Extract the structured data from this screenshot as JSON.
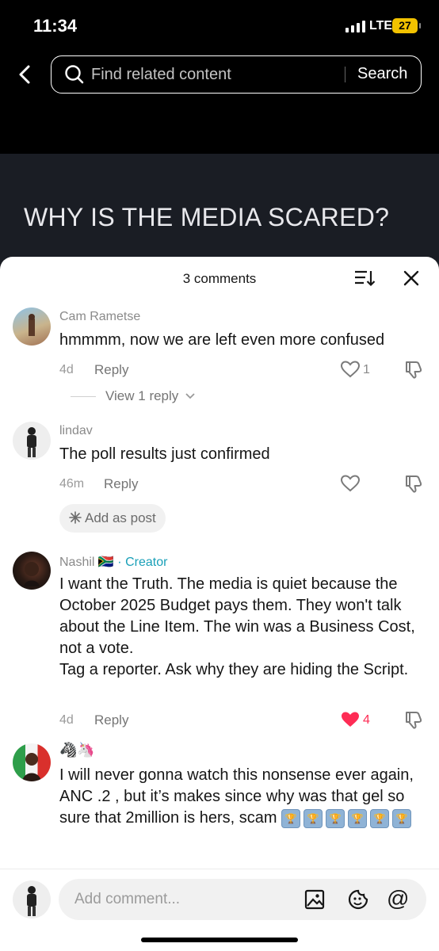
{
  "status_bar": {
    "time": "11:34",
    "network": "LTE",
    "battery": "27"
  },
  "search": {
    "placeholder": "Find related content",
    "button_label": "Search"
  },
  "video": {
    "title": "WHY IS THE MEDIA SCARED?"
  },
  "comments_sheet": {
    "title": "3 comments",
    "comments": [
      {
        "username": "Cam Rametse",
        "text": "hmmmm, now we are left even more confused",
        "age": "4d",
        "reply_label": "Reply",
        "likes": "1",
        "view_replies": "View 1 reply"
      },
      {
        "username": "lindav",
        "text": "The poll results just confirmed",
        "age": "46m",
        "reply_label": "Reply",
        "add_as_post": "Add as post"
      },
      {
        "username": "Nashil",
        "flag": "🇿🇦",
        "creator_label": "· Creator",
        "text": "I want the Truth. The media is quiet because the October 2025 Budget pays them. They won't talk about the Line Item. The win was a Business Cost, not a vote.\nTag a reporter. Ask why they are hiding the Script.",
        "age": "4d",
        "reply_label": "Reply",
        "likes": "4"
      },
      {
        "username": "🦓🦄",
        "text": "I will never gonna watch this nonsense ever again, ANC .2 , but it’s makes since why was that gel so sure that 2million is hers, scam"
      }
    ]
  },
  "comment_input": {
    "placeholder": "Add comment..."
  },
  "colors": {
    "liked": "#fe2c55",
    "creator": "#1aa0b8",
    "sheet_bg": "#ffffff"
  },
  "icons": [
    "back-icon",
    "search-icon",
    "sort-icon",
    "close-icon",
    "heart-icon",
    "dislike-icon",
    "sparkle-icon",
    "image-icon",
    "emoji-icon",
    "mention-icon"
  ]
}
